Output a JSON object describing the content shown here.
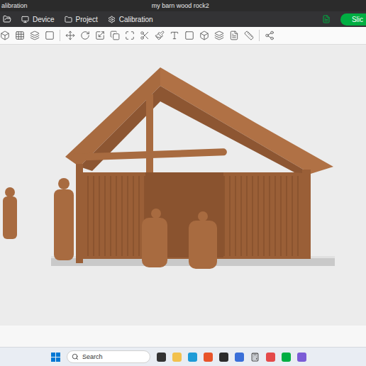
{
  "window": {
    "left_title": "alibration",
    "title": "my barn wood rock2"
  },
  "menu": [
    {
      "label": "Device",
      "selected": false
    },
    {
      "label": "Project",
      "selected": false
    },
    {
      "label": "Calibration",
      "selected": false
    }
  ],
  "slice_button": {
    "label": "Slic"
  },
  "taskbar": {
    "search": {
      "placeholder": "Search"
    }
  }
}
